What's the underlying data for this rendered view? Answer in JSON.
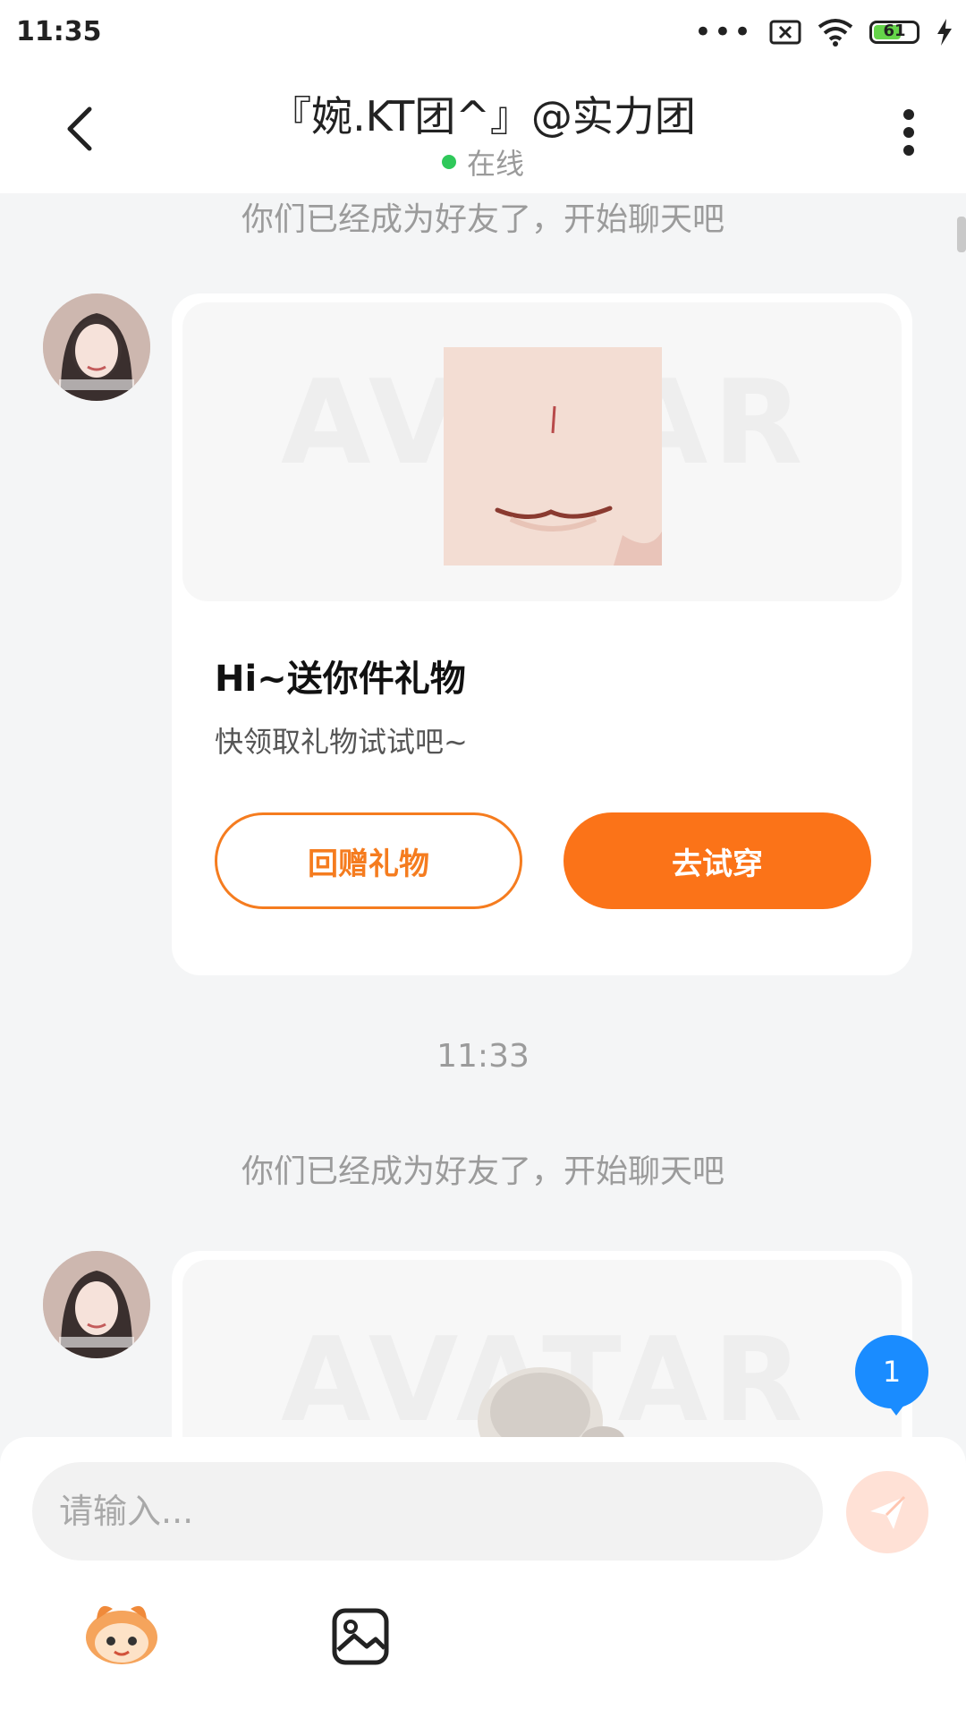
{
  "status_bar": {
    "time": "11:35",
    "battery": "61",
    "icons": [
      "more-dots-icon",
      "sim-off-icon",
      "wifi-icon",
      "battery-icon",
      "charging-icon"
    ]
  },
  "header": {
    "title": "『婉.KT团^』@实力团",
    "status": "在线"
  },
  "chat": {
    "system_notice_1": "你们已经成为好友了，开始聊天吧",
    "gift_card": {
      "title": "Hi~送你件礼物",
      "subtitle": "快领取礼物试试吧~",
      "button_return": "回赠礼物",
      "button_try": "去试穿",
      "media_watermark": "AVATAR"
    },
    "timestamp": "11:33",
    "system_notice_2": "你们已经成为好友了，开始聊天吧",
    "unread_badge": "1"
  },
  "composer": {
    "placeholder": "请输入..."
  },
  "colors": {
    "accent": "#fb7318",
    "online": "#2fc85a",
    "badge": "#1a8cff"
  }
}
